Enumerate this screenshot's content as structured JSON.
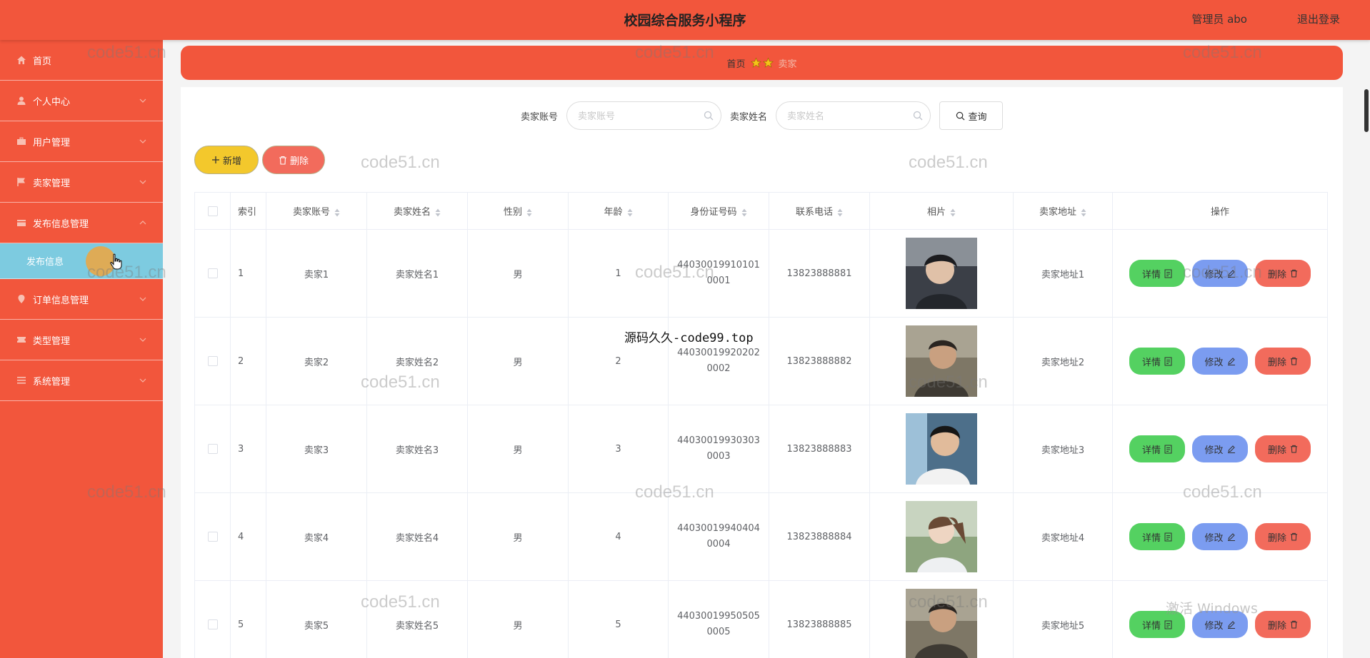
{
  "header": {
    "title": "校园综合服务小程序",
    "user": "管理员 abo",
    "logout": "退出登录"
  },
  "sidebar": {
    "items": [
      {
        "label": "首页",
        "icon": "home-icon"
      },
      {
        "label": "个人中心",
        "icon": "user-icon"
      },
      {
        "label": "用户管理",
        "icon": "briefcase-icon"
      },
      {
        "label": "卖家管理",
        "icon": "flag-icon"
      },
      {
        "label": "发布信息管理",
        "icon": "card-icon"
      },
      {
        "label": "订单信息管理",
        "icon": "location-icon"
      },
      {
        "label": "类型管理",
        "icon": "ticket-icon"
      },
      {
        "label": "系统管理",
        "icon": "list-icon"
      }
    ],
    "submenu": {
      "label": "发布信息"
    }
  },
  "breadcrumb": {
    "home": "首页",
    "current": "卖家"
  },
  "search": {
    "account_label": "卖家账号",
    "account_placeholder": "卖家账号",
    "name_label": "卖家姓名",
    "name_placeholder": "卖家姓名",
    "query": "查询"
  },
  "actions": {
    "add": "新增",
    "delete": "删除"
  },
  "table": {
    "headers": [
      "索引",
      "卖家账号",
      "卖家姓名",
      "性别",
      "年龄",
      "身份证号码",
      "联系电话",
      "相片",
      "卖家地址",
      "操作"
    ],
    "rows": [
      {
        "index": "1",
        "account": "卖家1",
        "name": "卖家姓名1",
        "gender": "男",
        "age": "1",
        "idcard": "440300199101010001",
        "phone": "13823888881",
        "address": "卖家地址1"
      },
      {
        "index": "2",
        "account": "卖家2",
        "name": "卖家姓名2",
        "gender": "男",
        "age": "2",
        "idcard": "440300199202020002",
        "phone": "13823888882",
        "address": "卖家地址2"
      },
      {
        "index": "3",
        "account": "卖家3",
        "name": "卖家姓名3",
        "gender": "男",
        "age": "3",
        "idcard": "440300199303030003",
        "phone": "13823888883",
        "address": "卖家地址3"
      },
      {
        "index": "4",
        "account": "卖家4",
        "name": "卖家姓名4",
        "gender": "男",
        "age": "4",
        "idcard": "440300199404040004",
        "phone": "13823888884",
        "address": "卖家地址4"
      },
      {
        "index": "5",
        "account": "卖家5",
        "name": "卖家姓名5",
        "gender": "男",
        "age": "5",
        "idcard": "440300199505050005",
        "phone": "13823888885",
        "address": "卖家地址5"
      }
    ],
    "ops": {
      "detail": "详情",
      "edit": "修改",
      "delete": "删除"
    }
  },
  "watermark": {
    "repeat": "code51.cn",
    "main": "源码久久-code99.top",
    "activate": "激活 Windows"
  },
  "colors": {
    "brand": "#f2563c",
    "submenu": "#7dcbe0",
    "add": "#f3c82c",
    "detail": "#54d161",
    "edit": "#7b9cf0",
    "delete": "#f26b5c"
  }
}
